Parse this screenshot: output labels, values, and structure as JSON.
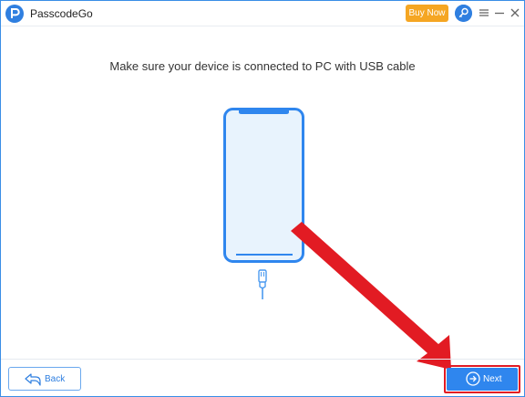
{
  "app": {
    "title": "PasscodeGo",
    "buy_label": "Buy Now",
    "icons": {
      "logo": "passcodego-logo-icon",
      "key": "key-search-icon",
      "menu": "menu-icon",
      "minimize": "minimize-icon",
      "close": "close-icon"
    }
  },
  "main": {
    "instruction": "Make sure your device is connected to PC with USB cable",
    "illustration": "phone-icon",
    "cable": "usb-cable-icon"
  },
  "footer": {
    "back_label": "Back",
    "next_label": "Next"
  },
  "colors": {
    "accent": "#2f86ee",
    "buy": "#f5a623",
    "highlight": "#e21b23"
  }
}
